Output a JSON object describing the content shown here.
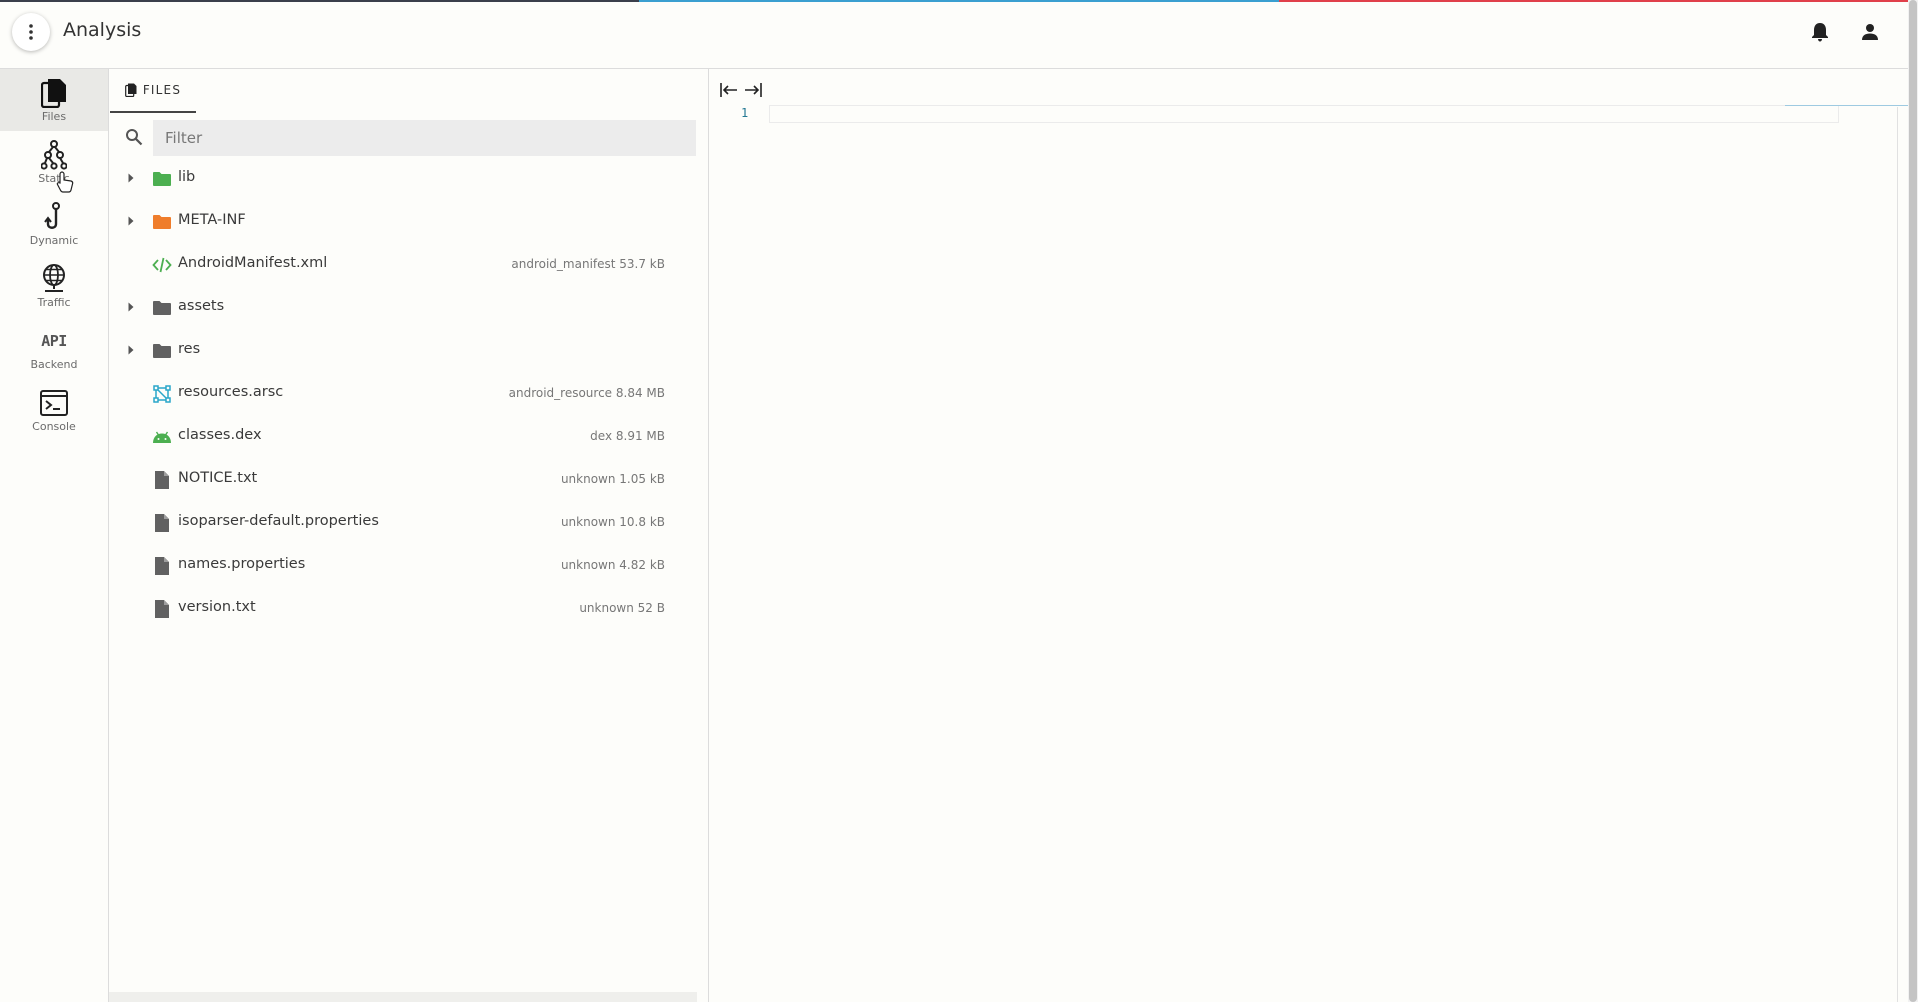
{
  "colors": {
    "stripe": [
      "#3a3f4b",
      "#3a9fd0",
      "#e0404a"
    ],
    "folder_green": "#4caf50",
    "folder_orange": "#ef7d2b",
    "folder_gray": "#616161",
    "xml_green": "#4caf50",
    "dex_green": "#4caf50",
    "arsc_blue": "#2aa7c9",
    "line_number": "#237893"
  },
  "header": {
    "title": "Analysis",
    "menu_icon": "more-vert-icon",
    "notifications_icon": "bell-icon",
    "account_icon": "person-icon"
  },
  "rail": {
    "items": [
      {
        "label": "Files",
        "icon": "files-icon",
        "active": true
      },
      {
        "label": "Static",
        "icon": "graph-icon",
        "active": false
      },
      {
        "label": "Dynamic",
        "icon": "hook-icon",
        "active": false
      },
      {
        "label": "Traffic",
        "icon": "globe-icon",
        "active": false
      },
      {
        "label": "Backend",
        "icon": "api-icon",
        "icon_text": "API",
        "active": false
      },
      {
        "label": "Console",
        "icon": "terminal-icon",
        "active": false
      }
    ]
  },
  "files": {
    "tab_label": "FILES",
    "filter_placeholder": "Filter",
    "tree": [
      {
        "name": "lib",
        "type": "folder",
        "color": "green",
        "expandable": true,
        "meta": ""
      },
      {
        "name": "META-INF",
        "type": "folder",
        "color": "orange",
        "expandable": true,
        "meta": ""
      },
      {
        "name": "AndroidManifest.xml",
        "type": "xml",
        "expandable": false,
        "meta": "android_manifest 53.7 kB"
      },
      {
        "name": "assets",
        "type": "folder",
        "color": "gray",
        "expandable": true,
        "meta": ""
      },
      {
        "name": "res",
        "type": "folder",
        "color": "gray",
        "expandable": true,
        "meta": ""
      },
      {
        "name": "resources.arsc",
        "type": "arsc",
        "expandable": false,
        "meta": "android_resource 8.84 MB"
      },
      {
        "name": "classes.dex",
        "type": "dex",
        "expandable": false,
        "meta": "dex 8.91 MB"
      },
      {
        "name": "NOTICE.txt",
        "type": "file",
        "expandable": false,
        "meta": "unknown 1.05 kB"
      },
      {
        "name": "isoparser-default.properties",
        "type": "file",
        "expandable": false,
        "meta": "unknown 10.8 kB"
      },
      {
        "name": "names.properties",
        "type": "file",
        "expandable": false,
        "meta": "unknown 4.82 kB"
      },
      {
        "name": "version.txt",
        "type": "file",
        "expandable": false,
        "meta": "unknown 52 B"
      }
    ]
  },
  "editor": {
    "collapse_icon": "collapse-left-icon",
    "expand_icon": "expand-right-icon",
    "line_numbers": [
      "1"
    ]
  }
}
